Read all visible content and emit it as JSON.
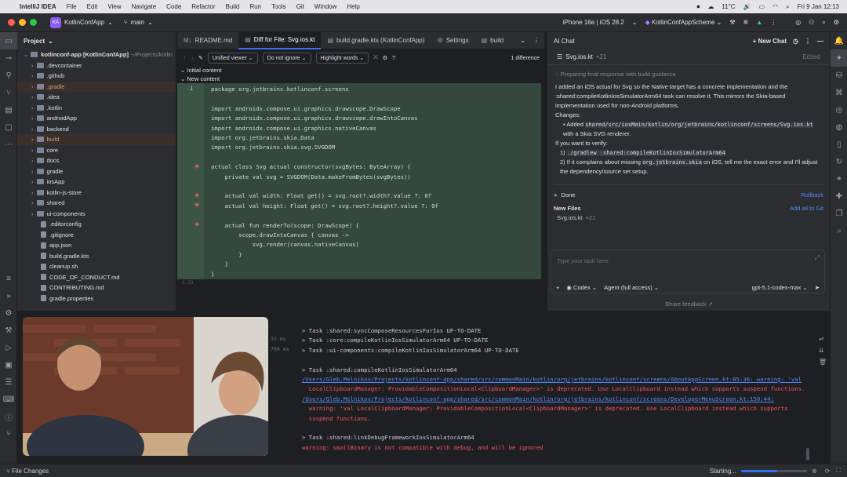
{
  "macbar": {
    "app": "IntelliJ IDEA",
    "menus": [
      "File",
      "Edit",
      "View",
      "Navigate",
      "Code",
      "Refactor",
      "Build",
      "Run",
      "Tools",
      "Git",
      "Window",
      "Help"
    ],
    "temp": "11°C",
    "datetime": "Fri 9 Jan 12:13"
  },
  "titlebar": {
    "project": "KotlinConfApp",
    "branch": "main",
    "device": "iPhone 16e | iOS 28.2",
    "scheme": "KotlinConfAppScheme"
  },
  "project": {
    "title": "Project",
    "root": "kotlinconf-app [KotlinConfApp]",
    "root_path": "~/Projects/kotlin",
    "items": [
      ".devcontainer",
      ".github",
      ".gradle",
      ".idea",
      ".kotlin",
      "androidApp",
      "backend",
      "build",
      "core",
      "docs",
      "gradle",
      "iosApp",
      "kotlin-js-store",
      "shared",
      "ui-components"
    ],
    "files": [
      ".editorconfig",
      ".gitignore",
      "app.json",
      "build.gradle.kts",
      "cleanup.sh",
      "CODE_OF_CONDUCT.md",
      "CONTRIBUTING.md",
      "gradle.properties"
    ]
  },
  "editor": {
    "tabs": [
      "README.md",
      "Diff for File: Svg.ios.kt",
      "build.gradle.kts (KotlinConfApp)",
      "Settings",
      "build"
    ],
    "viewer": "Unified viewer",
    "ignore": "Do not ignore",
    "highlight": "Highlight words",
    "difference": "1 difference",
    "initial": "Initial content",
    "new": "New content",
    "code": [
      "package org.jetbrains.kotlinconf.screens",
      "",
      "import androidx.compose.ui.graphics.drawscope.DrawScope",
      "import androidx.compose.ui.graphics.drawscope.drawIntoCanvas",
      "import androidx.compose.ui.graphics.nativeCanvas",
      "import org.jetbrains.skia.Data",
      "import org.jetbrains.skia.svg.SVGDOM",
      "",
      "actual class Svg actual constructor(svgBytes: ByteArray) {",
      "    private val svg = SVGDOM(Data.makeFromBytes(svgBytes))",
      "",
      "    actual val width: Float get() = svg.root?.width?.value ?: 0f",
      "    actual val height: Float get() = svg.root?.height?.value ?: 0f",
      "",
      "    actual fun renderTo(scope: DrawScope) {",
      "        scope.drawIntoCanvas { canvas ->",
      "            svg.render(canvas.nativeCanvas)",
      "        }",
      "    }",
      "}"
    ],
    "line_no": "1",
    "line_no2": "1 23"
  },
  "ai": {
    "title": "AI Chat",
    "new_chat": "New Chat",
    "file": "Svg.ios.kt",
    "file_delta": "+21",
    "edited": "Edited",
    "preparing": "Preparing final response with build guidance",
    "p1": "I added an iOS actual for Svg so the Native target has a concrete implementation and the :shared:compileKotlinIosSimulatorArm64 task can resolve it. This mirrors the Skia-based implementation used for non-Android platforms.",
    "changes": "Changes:",
    "bullet_pre": "Added",
    "bullet_path": "shared/src/iosMain/kotlin/org/jetbrains/kotlinconf/screens/Svg.ios.kt",
    "bullet_post": "with a Skia SVG renderer.",
    "verify": "If you want to verify:",
    "v1": "./gradlew :shared:compileKotlinIosSimulatorArm64",
    "v2_pre": "If it complains about missing",
    "v2_code": "org.jetbrains.skia",
    "v2_post": "on iOS, tell me the exact error and I'll adjust the dependency/source set setup.",
    "done": "Done",
    "rollback": "Rollback",
    "new_files": "New Files",
    "add_all": "Add all to Git",
    "nf_name": "Svg.ios.kt",
    "nf_delta": "+21",
    "placeholder": "Type your task here",
    "agent": "Codex",
    "mode": "Agent (full access)",
    "model": "gpt-5.1-codex-max",
    "feedback": "Share feedback ↗"
  },
  "console": {
    "time1": "31 ms",
    "time2": "760 ms",
    "lines": [
      {
        "t": "> Task :shared:syncComposeResourcesForIos UP-TO-DATE",
        "c": "n"
      },
      {
        "t": "> Task :core:compileKotlinIosSimulatorArm64 UP-TO-DATE",
        "c": "n"
      },
      {
        "t": "> Task :ui-components:compileKotlinIosSimulatorArm64 UP-TO-DATE",
        "c": "n"
      },
      {
        "t": "",
        "c": "n"
      },
      {
        "t": "> Task :shared:compileKotlinIosSimulatorArm64",
        "c": "n"
      },
      {
        "t": "/Users/Gleb.Melnikov/Projects/kotlinconf-app/shared/src/commonMain/kotlin/org/jetbrains/kotlinconf/screens/AboutAppScreen.kt:85:36: warning: 'val",
        "c": "l"
      },
      {
        "t": "  LocalClipboardManager: ProvidableCompositionLocal<ClipboardManager>' is deprecated. Use LocalClipboard instead which supports suspend functions.",
        "c": "e"
      },
      {
        "t": "/Users/Gleb.Melnikov/Projects/kotlinconf-app/shared/src/commonMain/kotlin/org/jetbrains/kotlinconf/screens/DeveloperMenuScreen.kt:150:44:",
        "c": "l"
      },
      {
        "t": "  warning: 'val LocalClipboardManager: ProvidableCompositionLocal<ClipboardManager>' is deprecated. Use LocalClipboard instead which supports",
        "c": "e"
      },
      {
        "t": "  suspend functions.",
        "c": "e"
      },
      {
        "t": "",
        "c": "n"
      },
      {
        "t": "> Task :shared:linkDebugFrameworkIosSimulatorArm64",
        "c": "n"
      },
      {
        "t": "warning: smallBinary is not compatible with debug, and will be ignored",
        "c": "e"
      }
    ]
  },
  "status": {
    "file_changes": "File Changes",
    "starting": "Starting...",
    "progress": 0.55
  }
}
